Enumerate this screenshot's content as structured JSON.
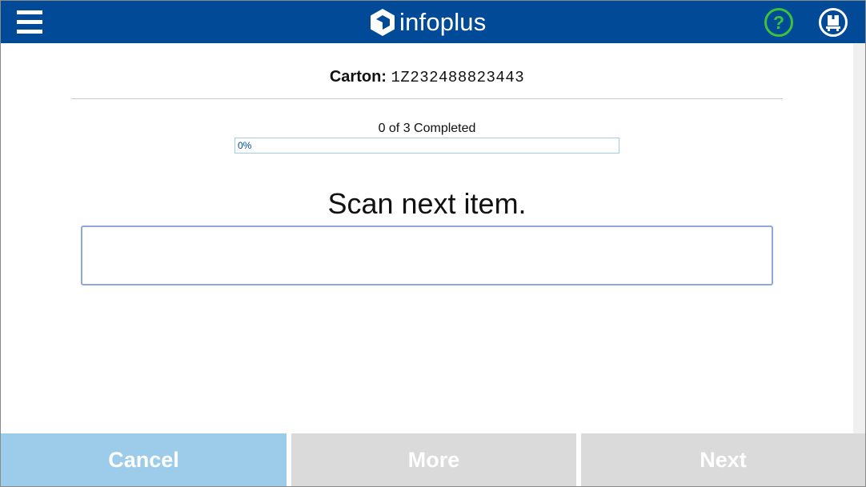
{
  "header": {
    "brand": "infoplus",
    "menu_icon": "hamburger-menu-icon",
    "help_icon": "help-circle-icon",
    "user_icon": "user-badge-icon",
    "colors": {
      "bar": "#004a98",
      "help": "#3ec13c",
      "white": "#ffffff"
    }
  },
  "carton": {
    "label": "Carton:",
    "value": "1Z232488823443"
  },
  "progress": {
    "text": "0 of 3 Completed",
    "percent_label": "0%",
    "completed": 0,
    "total": 3,
    "percent": 0
  },
  "scan": {
    "title": "Scan next item.",
    "value": ""
  },
  "footer": {
    "cancel": "Cancel",
    "more": "More",
    "next": "Next",
    "colors": {
      "cancel": "#9dcbea",
      "disabled": "#dadada"
    }
  }
}
